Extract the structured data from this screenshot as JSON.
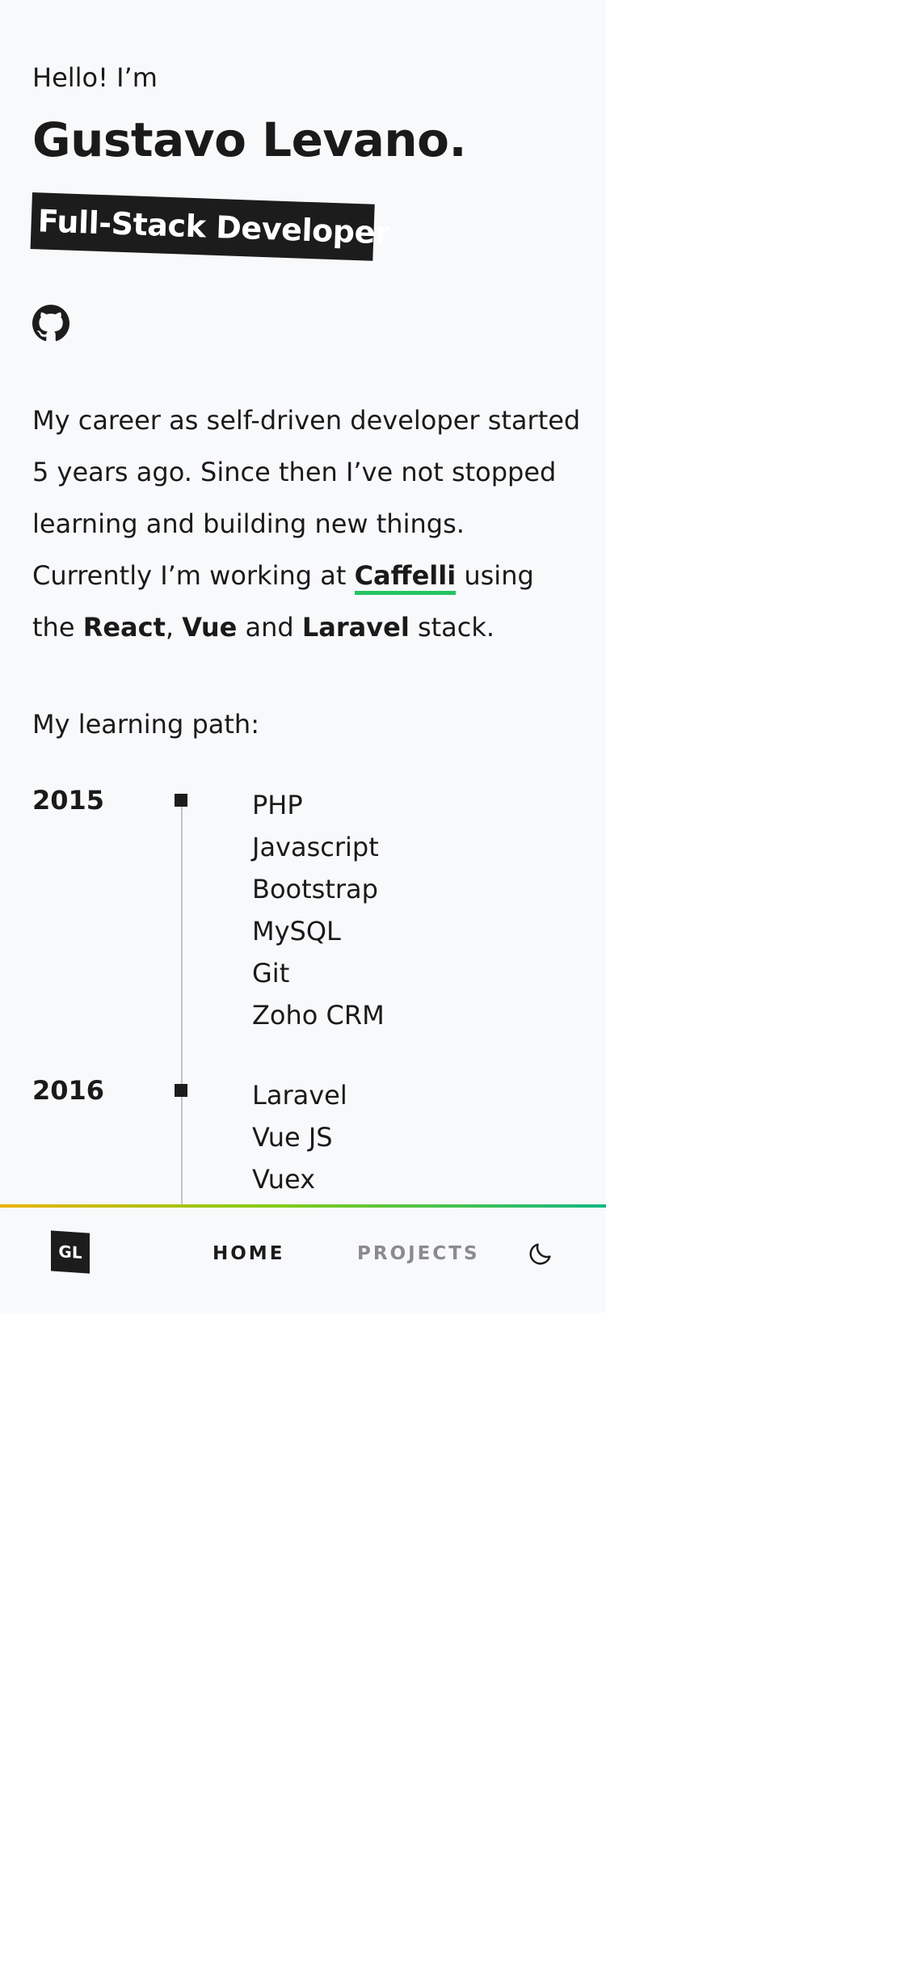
{
  "hero": {
    "greeting": "Hello! I’m",
    "name": "Gustavo Levano.",
    "role": "Full-Stack Developer",
    "social_icon": "github-icon"
  },
  "bio": {
    "part1": "My career as self-driven developer started 5 years ago. Since then I’ve not stopped learning and building new things. Currently I’m working at ",
    "company": "Caffelli",
    "part2": " using the ",
    "tech1": "React",
    "sep1": ", ",
    "tech2": "Vue",
    "part3": " and ",
    "tech3": "Laravel",
    "part4": " stack.",
    "link_color": "#22c55e"
  },
  "learning": {
    "label": "My learning path:",
    "entries": [
      {
        "year": "2015",
        "items": [
          "PHP",
          "Javascript",
          "Bootstrap",
          "MySQL",
          "Git",
          "Zoho CRM"
        ]
      },
      {
        "year": "2016",
        "items": [
          "Laravel",
          "Vue JS",
          "Vuex"
        ]
      }
    ]
  },
  "nav": {
    "logo": "GL",
    "home": "HOME",
    "projects": "PROJECTS",
    "theme_icon": "moon-icon",
    "gradient": [
      "#eab308",
      "#84cc16",
      "#10b981"
    ]
  }
}
